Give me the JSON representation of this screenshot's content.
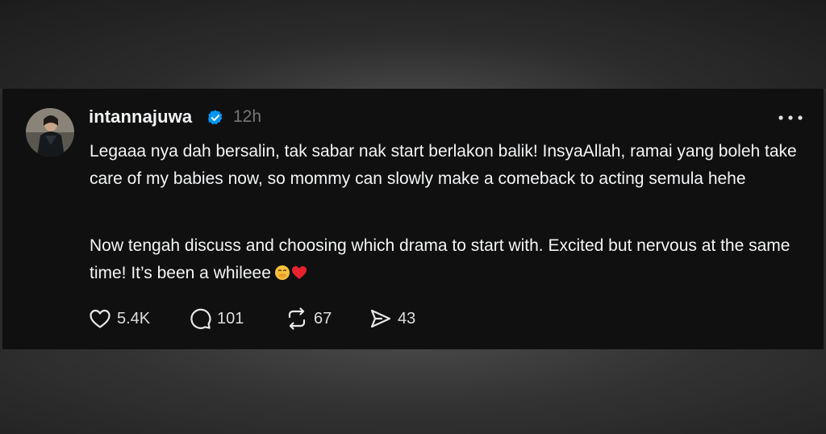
{
  "post": {
    "username": "intannajuwa",
    "timestamp": "12h",
    "paragraph1": "Legaaa nya dah bersalin, tak sabar nak start berlakon balik! InsyaAllah, ramai yang boleh take care of my babies now, so mommy can slowly make a comeback to acting semula hehe",
    "paragraph2": "Now tengah discuss and choosing which drama to start with. Excited but nervous at the same time! It’s been a whileee",
    "emojis": [
      "face-with-hand-over-mouth",
      "red-heart"
    ],
    "verified_color": "#0095f6"
  },
  "actions": {
    "likes": "5.4K",
    "replies": "101",
    "reposts": "67",
    "shares": "43"
  }
}
